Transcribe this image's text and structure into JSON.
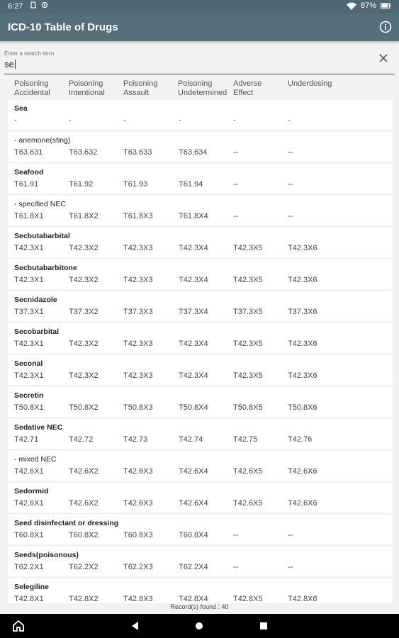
{
  "status": {
    "time": "6:27",
    "battery": "87%"
  },
  "appbar": {
    "title": "ICD-10 Table of Drugs"
  },
  "search": {
    "label": "Enter a search term",
    "value": "se"
  },
  "columns": [
    "Poisoning\nAccidental",
    "Poisoning\nIntentional",
    "Poisoning\nAssault",
    "Poisoning\nUndetermined",
    "Adverse\nEffect",
    "Underdosing"
  ],
  "rows": [
    {
      "name": "Sea",
      "bold": true,
      "codes": [
        "-",
        "-",
        "-",
        "-",
        "-",
        "-"
      ]
    },
    {
      "name": "- anemone(sting)",
      "bold": false,
      "codes": [
        "T63.631",
        "T63.632",
        "T63.633",
        "T63.634",
        "--",
        "--"
      ]
    },
    {
      "name": "Seafood",
      "bold": true,
      "codes": [
        "T61.91",
        "T61.92",
        "T61.93",
        "T61.94",
        "--",
        "--"
      ]
    },
    {
      "name": "- specified NEC",
      "bold": false,
      "codes": [
        "T61.8X1",
        "T61.8X2",
        "T61.8X3",
        "T61.8X4",
        "--",
        "--"
      ]
    },
    {
      "name": "Secbutabarbital",
      "bold": true,
      "codes": [
        "T42.3X1",
        "T42.3X2",
        "T42.3X3",
        "T42.3X4",
        "T42.3X5",
        "T42.3X6"
      ]
    },
    {
      "name": "Secbutabarbitone",
      "bold": true,
      "codes": [
        "T42.3X1",
        "T42.3X2",
        "T42.3X3",
        "T42.3X4",
        "T42.3X5",
        "T42.3X6"
      ]
    },
    {
      "name": "Secnidazole",
      "bold": true,
      "codes": [
        "T37.3X1",
        "T37.3X2",
        "T37.3X3",
        "T37.3X4",
        "T37.3X5",
        "T37.3X6"
      ]
    },
    {
      "name": "Secobarbital",
      "bold": true,
      "codes": [
        "T42.3X1",
        "T42.3X2",
        "T42.3X3",
        "T42.3X4",
        "T42.3X5",
        "T42.3X6"
      ]
    },
    {
      "name": "Seconal",
      "bold": true,
      "codes": [
        "T42.3X1",
        "T42.3X2",
        "T42.3X3",
        "T42.3X4",
        "T42.3X5",
        "T42.3X6"
      ]
    },
    {
      "name": "Secretin",
      "bold": true,
      "codes": [
        "T50.8X1",
        "T50.8X2",
        "T50.8X3",
        "T50.8X4",
        "T50.8X5",
        "T50.8X6"
      ]
    },
    {
      "name": "Sedative NEC",
      "bold": true,
      "codes": [
        "T42.71",
        "T42.72",
        "T42.73",
        "T42.74",
        "T42.75",
        "T42.76"
      ]
    },
    {
      "name": "- mixed NEC",
      "bold": false,
      "codes": [
        "T42.6X1",
        "T42.6X2",
        "T42.6X3",
        "T42.6X4",
        "T42.6X5",
        "T42.6X6"
      ]
    },
    {
      "name": "Sedormid",
      "bold": true,
      "codes": [
        "T42.6X1",
        "T42.6X2",
        "T42.6X3",
        "T42.6X4",
        "T42.6X5",
        "T42.6X6"
      ]
    },
    {
      "name": "Seed disinfectant or dressing",
      "bold": true,
      "codes": [
        "T60.8X1",
        "T60.8X2",
        "T60.8X3",
        "T60.8X4",
        "--",
        "--"
      ]
    },
    {
      "name": "Seeds(poisonous)",
      "bold": true,
      "codes": [
        "T62.2X1",
        "T62.2X2",
        "T62.2X3",
        "T62.2X4",
        "--",
        "--"
      ]
    },
    {
      "name": "Selegiline",
      "bold": true,
      "codes": [
        "T42.8X1",
        "T42.8X2",
        "T42.8X3",
        "T42.8X4",
        "T42.8X5",
        "T42.8X6"
      ]
    }
  ],
  "footer": {
    "records": "Record(s) found : 40"
  }
}
